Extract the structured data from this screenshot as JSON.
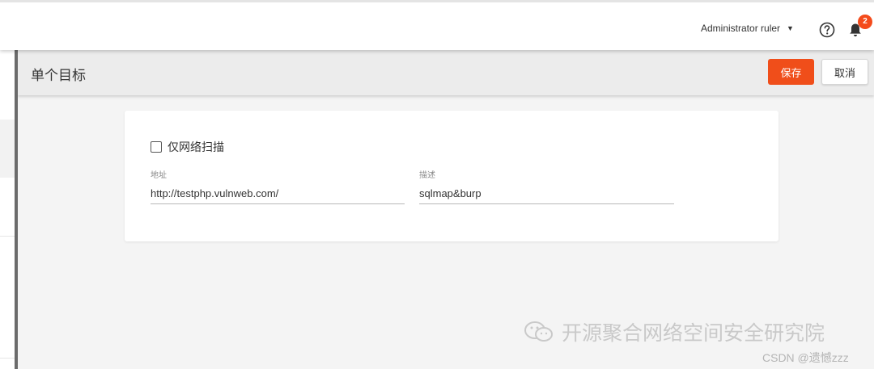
{
  "topbar": {
    "user_name": "Administrator ruler",
    "notification_count": "2"
  },
  "header": {
    "title": "单个目标",
    "save_label": "保存",
    "cancel_label": "取消"
  },
  "form": {
    "network_scan_only": {
      "label": "仅网络扫描",
      "checked": false
    },
    "address": {
      "label": "地址",
      "value": "http://testphp.vulnweb.com/"
    },
    "description": {
      "label": "描述",
      "value": "sqlmap&burp"
    }
  },
  "watermark": {
    "wechat_text": "开源聚合网络空间安全研究院",
    "csdn_text": "CSDN @遗憾zzz"
  },
  "colors": {
    "accent": "#f04e1a",
    "badge": "#f44b1b"
  }
}
